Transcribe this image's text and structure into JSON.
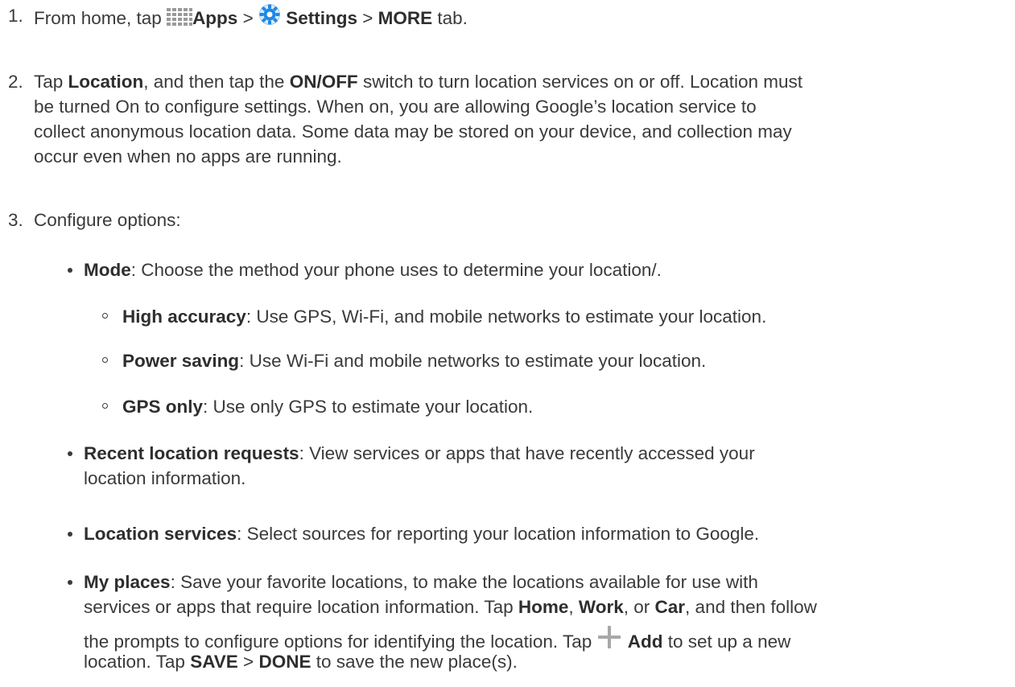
{
  "steps": [
    {
      "number": "1.",
      "parts": [
        "From home, tap ",
        "Apps",
        " > ",
        "Settings",
        " > ",
        "MORE",
        " tab."
      ],
      "icons": [
        "apps-grid-icon",
        "settings-gear-icon"
      ]
    },
    {
      "number": "2.",
      "line1_a": "Tap ",
      "line1_b": "Location",
      "line1_c": ", and then tap the ",
      "line1_d": "ON/OFF",
      "line1_e": " switch to turn location services on or off. Location must",
      "line2": "be turned On to configure settings. When on, you are allowing Google’s location service to",
      "line3": "collect anonymous location data. Some data may be stored on your device, and collection may",
      "line4": "occur even when no apps are running."
    },
    {
      "number": "3.",
      "text": "Configure options:"
    }
  ],
  "options": {
    "mode": {
      "label": "Mode",
      "text": ": Choose the method your phone uses to determine your location/."
    },
    "mode_sub": [
      {
        "label": "High accuracy",
        "text": ": Use GPS, Wi-Fi, and mobile networks to estimate your location."
      },
      {
        "label": "Power saving",
        "text": ": Use Wi-Fi and mobile networks to estimate your location."
      },
      {
        "label": "GPS only",
        "text": ": Use only GPS to estimate your location."
      }
    ],
    "recent": {
      "label": "Recent location requests",
      "line1": ": View services or apps that have recently accessed your",
      "line2": "location information."
    },
    "services": {
      "label": "Location services",
      "text": ": Select sources for reporting your location information to Google."
    },
    "places": {
      "label": "My places",
      "line1": ": Save your favorite locations, to make the locations available for use with",
      "line2_a": "services or apps that require location information. Tap ",
      "line2_home": "Home",
      "line2_b": ", ",
      "line2_work": "Work",
      "line2_c": ", or ",
      "line2_car": "Car",
      "line2_d": ", and then follow",
      "line3_a": "the prompts to configure options for identifying the location. Tap ",
      "line3_add": "Add",
      "line3_b": " to set up a new",
      "line4_a": "location. Tap ",
      "line4_save": "SAVE",
      "line4_b": " > ",
      "line4_done": "DONE",
      "line4_c": " to save the new place(s).",
      "icon": "plus-icon"
    }
  },
  "colors": {
    "text": "#3a3a3a",
    "apps_icon": "#9a9a9a",
    "settings_icon": "#1e88e5",
    "plus_icon": "#a8a8a8"
  }
}
